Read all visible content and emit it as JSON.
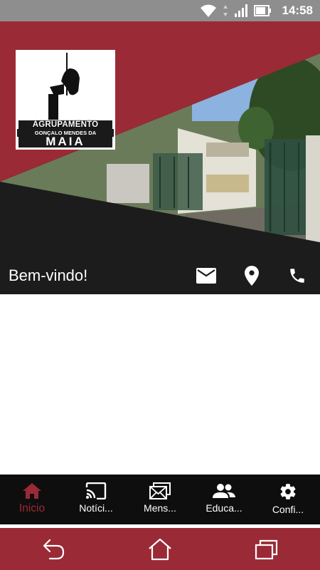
{
  "status_bar": {
    "time": "14:58",
    "icons": [
      "wifi-icon",
      "signal-icon",
      "battery-icon"
    ]
  },
  "header": {
    "logo": {
      "line1": "AGRUPAMENTO",
      "line2": "GONÇALO MENDES DA",
      "line3": "MAIA"
    },
    "welcome": "Bem-vindo!",
    "actions": [
      "mail-icon",
      "location-icon",
      "phone-icon"
    ]
  },
  "bottom_nav": {
    "items": [
      {
        "label": "Inicio",
        "icon": "home-icon",
        "active": true
      },
      {
        "label": "Notíci...",
        "icon": "cast-icon",
        "active": false
      },
      {
        "label": "Mens...",
        "icon": "messages-icon",
        "active": false
      },
      {
        "label": "Educa...",
        "icon": "people-icon",
        "active": false
      },
      {
        "label": "Confi...",
        "icon": "gear-icon",
        "active": false
      }
    ]
  },
  "colors": {
    "brand": "#9a2a35",
    "dark": "#1c1c1c",
    "status_bar": "#8e8e8e"
  }
}
